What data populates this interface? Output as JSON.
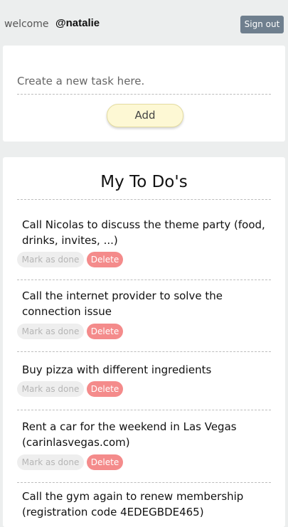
{
  "header": {
    "welcome_label": "welcome",
    "username": "@natalie",
    "signout_label": "Sign out"
  },
  "new_task": {
    "placeholder": "Create a new task here.",
    "add_label": "Add"
  },
  "todos": {
    "title": "My To Do's",
    "mark_label": "Mark as done",
    "delete_label": "Delete",
    "items": [
      {
        "text": "Call Nicolas to discuss the theme party (food, drinks, invites, ...)"
      },
      {
        "text": "Call the internet provider to solve the connection issue"
      },
      {
        "text": "Buy pizza with different ingredients"
      },
      {
        "text": "Rent a car for the weekend in Las Vegas (carinlasvegas.com)"
      },
      {
        "text": "Call the gym again to renew membership (registration code 4EDEGBDE465)"
      }
    ]
  },
  "colors": {
    "background": "#eceeee",
    "signout": "#6f7f8e",
    "add_button": "#fdf8d4",
    "delete_button": "#f48b8b",
    "mark_button": "#eeeeee"
  }
}
